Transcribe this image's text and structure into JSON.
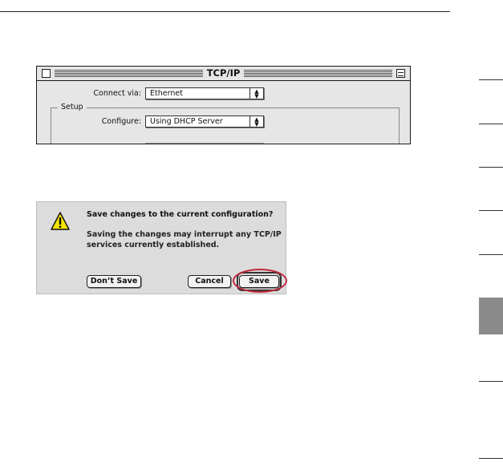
{
  "tcpip_window": {
    "title": "TCP/IP",
    "connect_via_label": "Connect via:",
    "connect_via_value": "Ethernet",
    "setup_label": "Setup",
    "configure_label": "Configure:",
    "configure_value": "Using DHCP Server"
  },
  "save_dialog": {
    "question": "Save changes to the current configuration?",
    "message_line1": "Saving the changes may interrupt any TCP/IP",
    "message_line2": "services currently established.",
    "dont_save_label": "Don’t Save",
    "cancel_label": "Cancel",
    "save_label": "Save"
  },
  "colors": {
    "highlight_oval": "#c0283a",
    "warning_icon_fill": "#f4e400",
    "section_tab_active": "#8a8a8a"
  },
  "icons": [
    "warning-icon",
    "close-box-icon",
    "zoom-box-icon",
    "popup-arrows-icon"
  ]
}
